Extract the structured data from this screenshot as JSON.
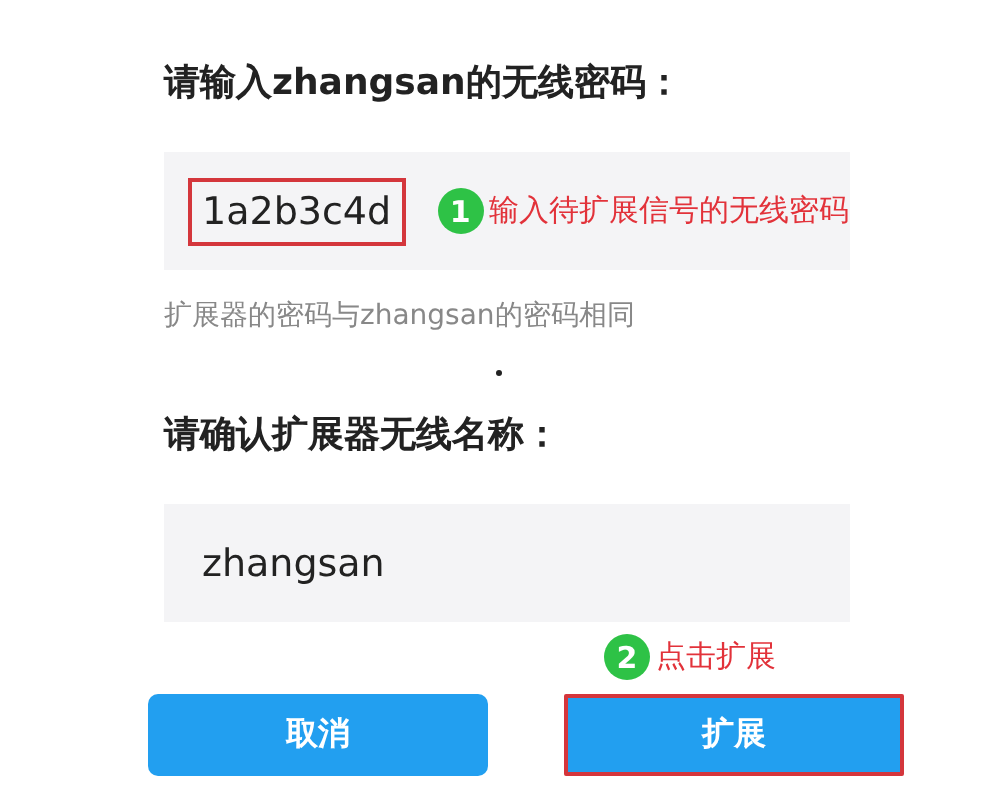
{
  "password_section": {
    "title": "请输入zhangsan的无线密码：",
    "field": {
      "value": "1a2b3c4d",
      "highlighted": true
    },
    "annotation": {
      "number": "1",
      "text": "输入待扩展信号的无线密码"
    },
    "hint": "扩展器的密码与zhangsan的密码相同"
  },
  "name_section": {
    "title": "请确认扩展器无线名称：",
    "field": {
      "value": "zhangsan",
      "highlighted": false
    }
  },
  "buttons": [
    {
      "label": "取消",
      "highlighted": false
    },
    {
      "label": "扩展",
      "highlighted": true,
      "annotation": {
        "number": "2",
        "text": "点击扩展"
      }
    }
  ]
}
